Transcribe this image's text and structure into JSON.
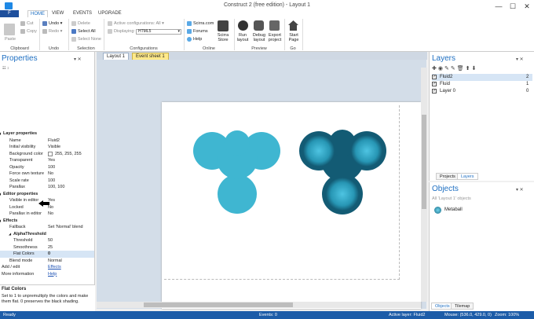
{
  "window": {
    "title": "Construct 2  (free edition) - Layout 1",
    "min": "—",
    "max": "☐",
    "close": "✕"
  },
  "menu": {
    "file": "F",
    "home": "HOME",
    "view": "VIEW",
    "events": "EVENTS",
    "upgrade": "UPGRADE",
    "home_key": "H",
    "view_key": "V",
    "events_key": "E"
  },
  "ribbon": {
    "paste": "Paste",
    "cut": "Cut",
    "copy": "Copy",
    "clipboard": "Clipboard",
    "undo": "Undo",
    "redo": "Redo",
    "undo_group": "Undo",
    "delete": "Delete",
    "select_all": "Select All",
    "select_none": "Select None",
    "selection": "Selection",
    "active_configurations": "Active configurations: All",
    "displaying": "Displaying:",
    "displaying_value": "HTML5",
    "configurations": "Configurations",
    "scirra_com": "Scirra.com",
    "forums": "Forums",
    "help": "Help",
    "scirra_store": "Scirra\nStore",
    "online": "Online",
    "run_layout": "Run\nlayout",
    "debug_layout": "Debug\nlayout",
    "export_project": "Export\nproject",
    "preview": "Preview",
    "start_page": "Start\nPage",
    "go": "Go"
  },
  "properties": {
    "title": "Properties",
    "rows": [
      {
        "type": "head",
        "k": "Layer properties",
        "v": ""
      },
      {
        "type": "row",
        "k": "Name",
        "v": "Fluid2"
      },
      {
        "type": "row",
        "k": "Initial visibility",
        "v": "Visible"
      },
      {
        "type": "row",
        "k": "Background color",
        "v": "255, 255, 255"
      },
      {
        "type": "row",
        "k": "Transparent",
        "v": "Yes"
      },
      {
        "type": "row",
        "k": "Opacity",
        "v": "100"
      },
      {
        "type": "row",
        "k": "Force own texture",
        "v": "No"
      },
      {
        "type": "row",
        "k": "Scale rate",
        "v": "100"
      },
      {
        "type": "row",
        "k": "Parallax",
        "v": "100, 100"
      },
      {
        "type": "head",
        "k": "Editor properties",
        "v": ""
      },
      {
        "type": "row",
        "k": "Visible in editor",
        "v": "Yes"
      },
      {
        "type": "row",
        "k": "Locked",
        "v": "No"
      },
      {
        "type": "row",
        "k": "Parallax in editor",
        "v": "No"
      },
      {
        "type": "head",
        "k": "Effects",
        "v": ""
      },
      {
        "type": "row",
        "k": "Fallback",
        "v": "Set 'Normal' blend"
      },
      {
        "type": "subhead",
        "k": "AlphaThreshold",
        "v": ""
      },
      {
        "type": "sub",
        "k": "Threshold",
        "v": "50"
      },
      {
        "type": "sub",
        "k": "Smoothness",
        "v": "25"
      },
      {
        "type": "sub-hl",
        "k": "Flat Colors",
        "v": "0"
      },
      {
        "type": "row",
        "k": "Blend mode",
        "v": "Normal"
      },
      {
        "type": "link",
        "k": "Add / edit",
        "v": "Effects"
      },
      {
        "type": "link",
        "k": "More information",
        "v": "Help"
      }
    ],
    "help_title": "Flat Colors",
    "help_text": "Set to 1 to unpremultiply the colors and make them flat. 0 preserves the black shading."
  },
  "tabs": {
    "layout": "Layout 1",
    "event_sheet": "Event sheet 1"
  },
  "layers": {
    "title": "Layers",
    "items": [
      {
        "name": "Fluid2",
        "num": "2"
      },
      {
        "name": "Fluid",
        "num": "1"
      },
      {
        "name": "Layer 0",
        "num": "0"
      }
    ],
    "tab_projects": "Projects",
    "tab_layers": "Layers"
  },
  "objects": {
    "title": "Objects",
    "filter": "All 'Layout 1' objects",
    "items": [
      {
        "name": "Metaball"
      }
    ],
    "tab_objects": "Objects",
    "tab_tilemap": "Tilemap"
  },
  "status": {
    "ready": "Ready",
    "events": "Events: 0",
    "active_layer": "Active layer: Fluid2",
    "mouse": "Mouse: (536.0, 429.0, 0)",
    "zoom": "Zoom: 100%"
  },
  "colors": {
    "accent": "#1e6fc2",
    "status": "#1c5ca8",
    "blob_flat": "#3fb6d1",
    "blob_dark": "#17607a"
  }
}
